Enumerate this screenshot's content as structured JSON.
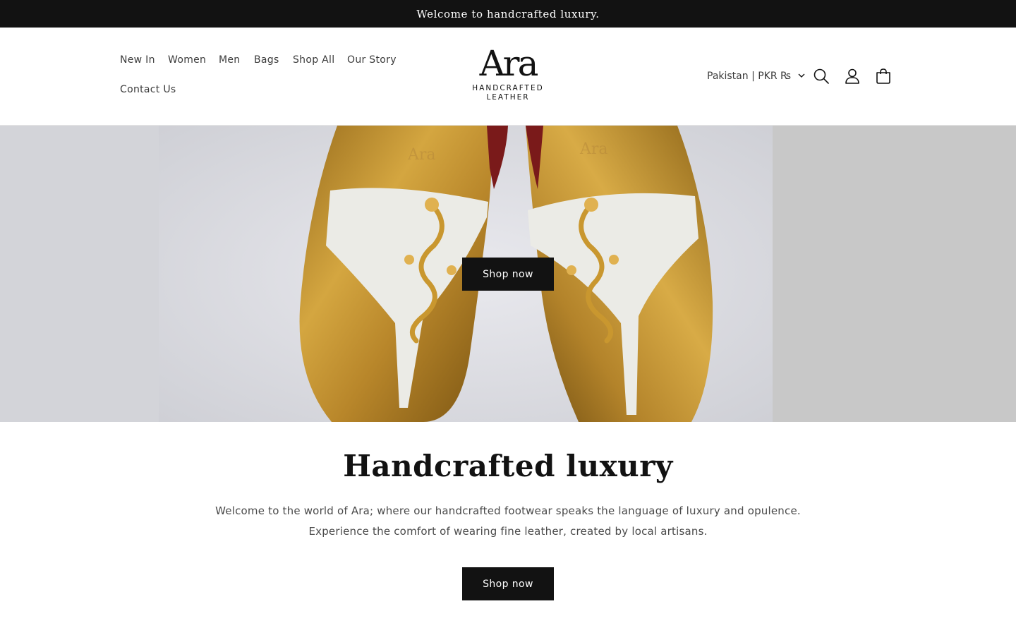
{
  "announcement": {
    "text": "Welcome to handcrafted luxury."
  },
  "nav": {
    "items": [
      {
        "label": "New In"
      },
      {
        "label": "Women"
      },
      {
        "label": "Men"
      },
      {
        "label": "Bags"
      },
      {
        "label": "Shop All"
      },
      {
        "label": "Our Story"
      },
      {
        "label": "Contact Us"
      }
    ]
  },
  "logo": {
    "mark": "Ara",
    "line1": "HANDCRAFTED",
    "line2": "LEATHER"
  },
  "header": {
    "locale_label": "Pakistan | PKR ₨",
    "icons": [
      "search-icon",
      "account-icon",
      "cart-icon"
    ]
  },
  "hero": {
    "image": "gold-leather-sandals-with-dragon-embellishment",
    "button_label": "Shop now"
  },
  "intro": {
    "title": "Handcrafted luxury",
    "line1": "Welcome to the world of Ara; where our handcrafted footwear speaks the language of luxury and opulence.",
    "line2": "Experience the comfort of wearing fine leather, created by local artisans.",
    "button_label": "Shop now"
  },
  "colors": {
    "primary": "#121212",
    "background": "#ffffff",
    "text_muted": "#4a4a4a",
    "gold": "#b88a2a"
  }
}
